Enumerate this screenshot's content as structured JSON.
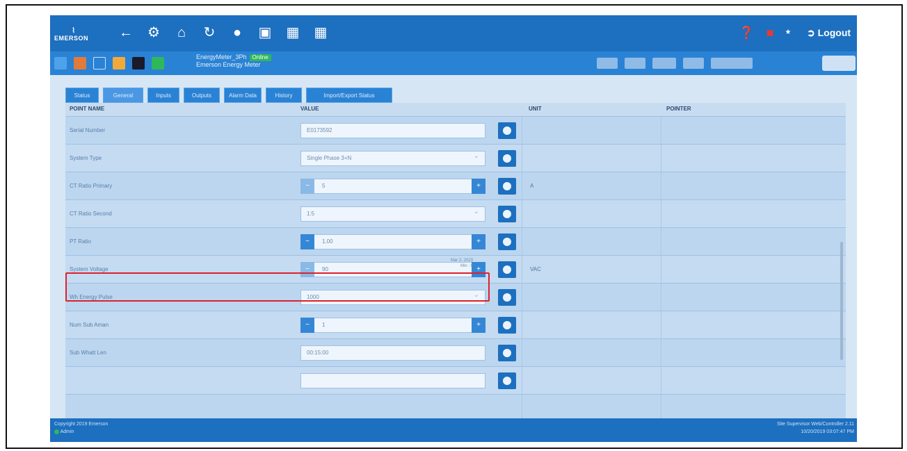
{
  "topbar": {
    "brand": "EMERSON",
    "logout_label": "Logout",
    "icons": [
      "back-arrow-icon",
      "gear-icon",
      "home-icon",
      "refresh-icon",
      "info-icon",
      "calendar-icon",
      "book-icon",
      "grid-icon"
    ],
    "right_icons": [
      "help-icon",
      "alarm-bell-icon",
      "logout-icon"
    ]
  },
  "device": {
    "name": "EnergyMeter_3Ph",
    "subtitle": "Emerson Energy Meter",
    "status": "Online"
  },
  "tabs": [
    "Status",
    "General",
    "Inputs",
    "Outputs",
    "Alarm Data",
    "History",
    "Import/Export Status"
  ],
  "active_tab": "General",
  "columns": {
    "point_name": "POINT NAME",
    "value": "VALUE",
    "unit": "UNIT",
    "pointer": "POINTER"
  },
  "rows": [
    {
      "name": "Serial Number",
      "value": "E0173592",
      "unit": ""
    },
    {
      "name": "System Type",
      "value": "Single Phase 3+N",
      "unit": ""
    },
    {
      "name": "CT Ratio Primary",
      "value": "5",
      "unit": "A"
    },
    {
      "name": "CT Ratio Second",
      "value": "1:5",
      "unit": ""
    },
    {
      "name": "PT Ratio",
      "value": "1.00",
      "unit": ""
    },
    {
      "name": "System Voltage",
      "value": "90",
      "unit": "VAC",
      "meta_line1": "Mar 2, 2023",
      "meta_line2": "Min : 0"
    },
    {
      "name": "Wh Energy Pulse",
      "value": "1000",
      "unit": ""
    },
    {
      "name": "Num Sub Aman",
      "value": "1",
      "unit": ""
    },
    {
      "name": "Sub Whatt Len",
      "value": "00:15:00",
      "unit": ""
    }
  ],
  "footer": {
    "copyright": "Copyright 2019 Emerson",
    "user": "Admin",
    "version": "Site Supervisor Web/Controller 2.11",
    "datetime": "10/20/2019 03:07:47 PM"
  },
  "colors": {
    "brand_blue": "#1d6fbf",
    "highlight": "#e0202a",
    "online": "#2fb85a"
  }
}
